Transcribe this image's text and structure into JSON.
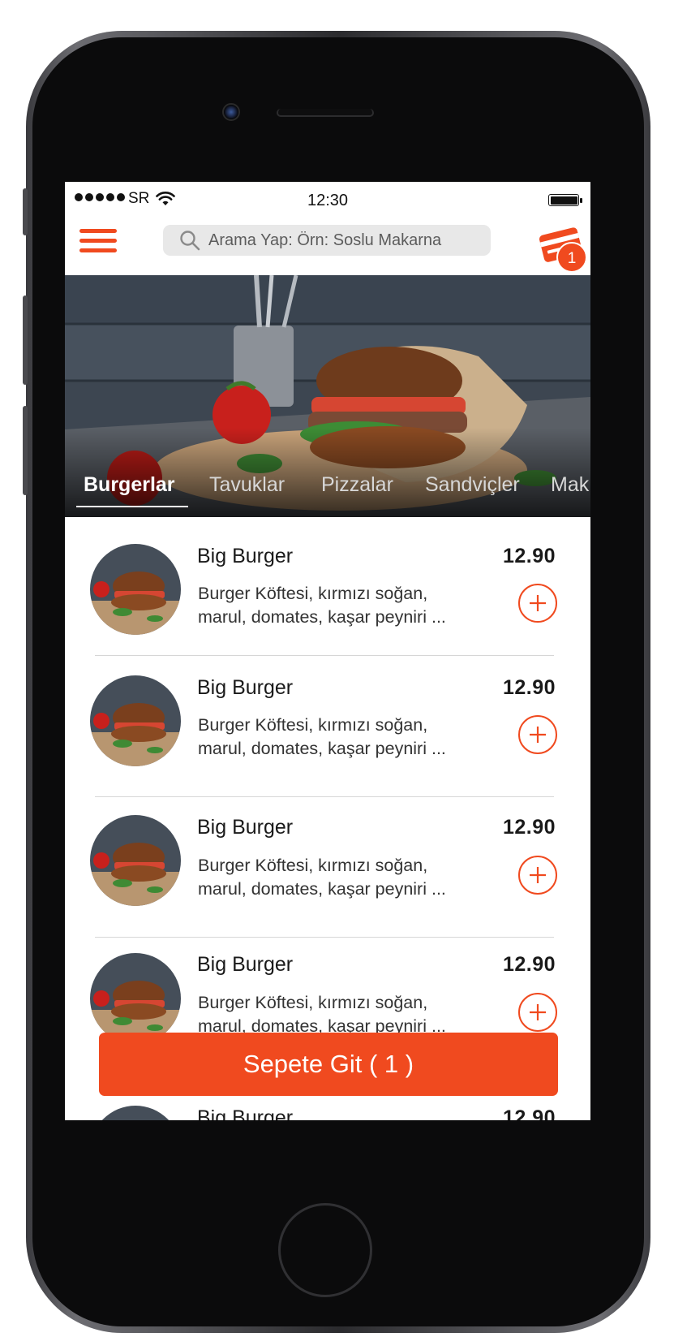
{
  "status_bar": {
    "carrier": "SR",
    "time": "12:30"
  },
  "nav": {
    "search_placeholder": "Arama Yap: Örn: Soslu Makarna",
    "cart_count": "1"
  },
  "categories": [
    {
      "label": "Burgerlar",
      "active": true
    },
    {
      "label": "Tavuklar",
      "active": false
    },
    {
      "label": "Pizzalar",
      "active": false
    },
    {
      "label": "Sandviçler",
      "active": false
    },
    {
      "label": "Mak",
      "active": false
    }
  ],
  "products": [
    {
      "name": "Big Burger",
      "price": "12.90",
      "desc_line1": "Burger Köftesi,   kırmızı soğan,",
      "desc_line2": "marul, domates, kaşar peyniri ..."
    },
    {
      "name": "Big Burger",
      "price": "12.90",
      "desc_line1": "Burger Köftesi,   kırmızı soğan,",
      "desc_line2": "marul, domates, kaşar peyniri ..."
    },
    {
      "name": "Big Burger",
      "price": "12.90",
      "desc_line1": "Burger Köftesi,   kırmızı soğan,",
      "desc_line2": "marul, domates, kaşar peyniri ..."
    },
    {
      "name": "Big Burger",
      "price": "12.90",
      "desc_line1": "Burger Köftesi,   kırmızı soğan,",
      "desc_line2": "marul, domates, kaşar peyniri ..."
    },
    {
      "name": "Big Burger",
      "price": "12.90",
      "desc_line1": "",
      "desc_line2": ""
    }
  ],
  "checkout": {
    "label": "Sepete Git ( 1 )"
  },
  "colors": {
    "accent": "#f04a1f",
    "text": "#1a1a1a",
    "divider": "#d6d6d6"
  }
}
